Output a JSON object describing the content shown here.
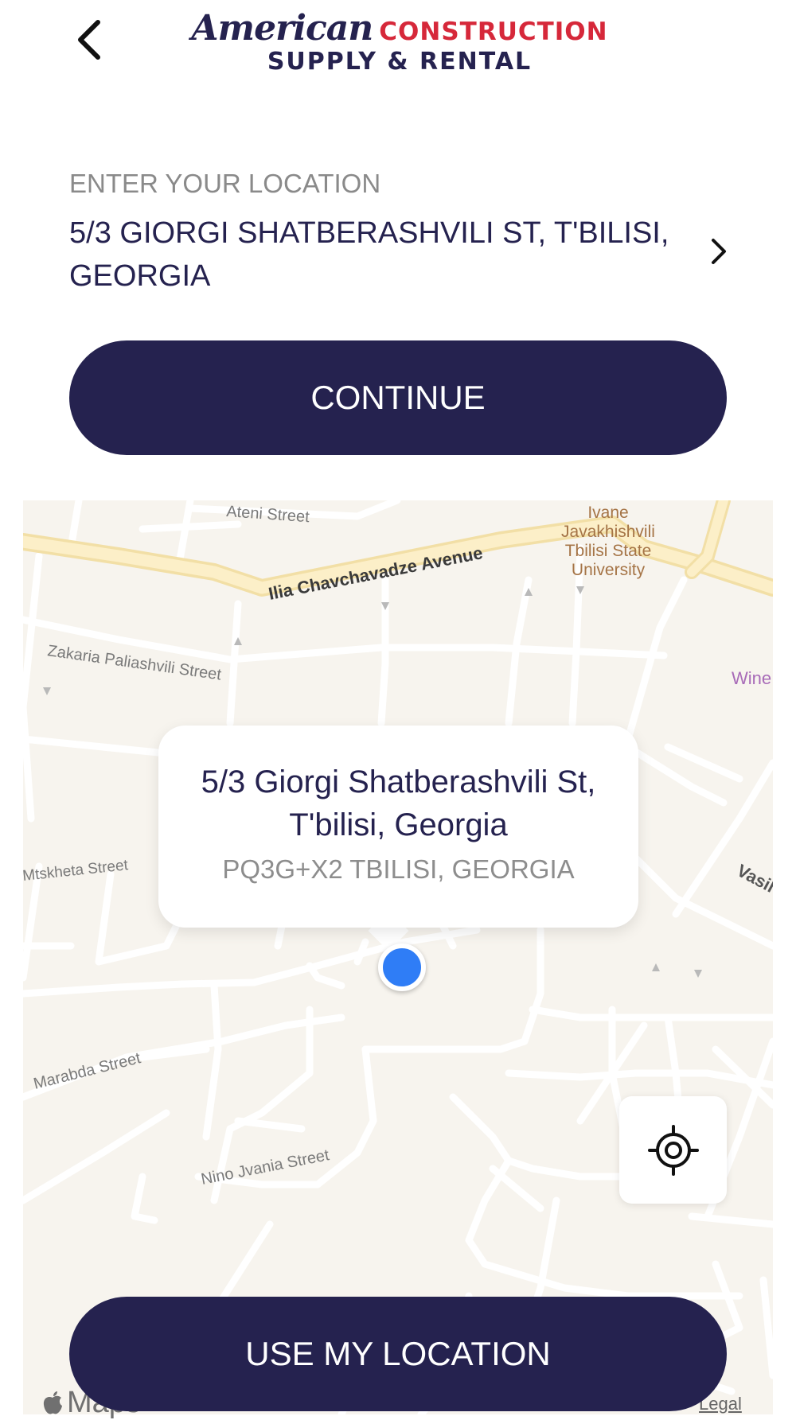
{
  "header": {
    "back_icon": "chevron-left-icon",
    "logo": {
      "line1_script": "American",
      "line1_block": "CONSTRUCTION",
      "line2": "SUPPLY & RENTAL"
    }
  },
  "location": {
    "label": "ENTER YOUR LOCATION",
    "value": "5/3 GIORGI SHATBERASHVILI ST, T'BILISI, GEORGIA",
    "chevron_icon": "chevron-right-icon"
  },
  "actions": {
    "continue_label": "CONTINUE",
    "use_location_label": "USE MY LOCATION"
  },
  "map": {
    "streets": {
      "ateni": "Ateni Street",
      "chavchavadze": "Ilia Chavchavadze Avenue",
      "paliashvili": "Zakaria Paliashvili Street",
      "mtskheta": "Mtskheta Street",
      "marabda": "Marabda Street",
      "jvania": "Nino Jvania Street",
      "vasil": "Vasil"
    },
    "poi": {
      "university_line1": "Ivane",
      "university_line2": "Javakhishvili",
      "university_line3": "Tbilisi State",
      "university_line4": "University",
      "wine": "Wine"
    },
    "callout": {
      "title": "5/3 Giorgi Shatberashvili St, T'bilisi, Georgia",
      "subtitle": "PQ3G+X2 TBILISI, GEORGIA"
    },
    "pin_color": "#2f7df6",
    "recenter_icon": "crosshair-target-icon",
    "attribution": "Maps",
    "legal": "Legal"
  },
  "colors": {
    "brand_navy": "#25224f",
    "brand_red": "#d6283a",
    "map_background": "#f7f4ee",
    "avenue": "#fbe9b7"
  }
}
